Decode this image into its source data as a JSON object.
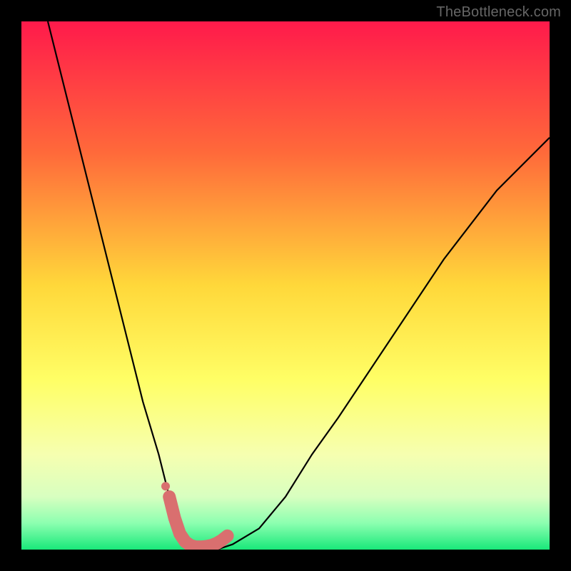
{
  "attribution": "TheBottleneck.com",
  "colors": {
    "frame": "#000000",
    "gradient_stops": [
      {
        "offset": 0,
        "color": "#ff1a4b"
      },
      {
        "offset": 0.25,
        "color": "#ff6a3a"
      },
      {
        "offset": 0.5,
        "color": "#ffd83a"
      },
      {
        "offset": 0.68,
        "color": "#ffff66"
      },
      {
        "offset": 0.82,
        "color": "#f6ffb0"
      },
      {
        "offset": 0.9,
        "color": "#d8ffc0"
      },
      {
        "offset": 0.95,
        "color": "#8cffb0"
      },
      {
        "offset": 1.0,
        "color": "#19e87a"
      }
    ],
    "curve": "#000000",
    "marker": "#d96f6f"
  },
  "chart_data": {
    "type": "line",
    "title": "",
    "xlabel": "",
    "ylabel": "",
    "xlim": [
      0,
      100
    ],
    "ylim": [
      0,
      100
    ],
    "series": [
      {
        "name": "bottleneck-curve",
        "x": [
          5,
          10,
          15,
          20,
          23,
          26,
          28,
          30,
          32,
          34,
          37,
          40,
          45,
          50,
          55,
          60,
          70,
          80,
          90,
          100
        ],
        "y": [
          100,
          80,
          60,
          40,
          28,
          18,
          10,
          4,
          1,
          0,
          0,
          1,
          4,
          10,
          18,
          25,
          40,
          55,
          68,
          78
        ]
      }
    ],
    "markers": {
      "name": "highlight-range",
      "x": [
        28,
        29,
        30,
        31,
        32,
        33,
        34,
        35,
        36,
        37,
        38,
        39
      ],
      "y": [
        10,
        6,
        3,
        1.5,
        0.8,
        0.5,
        0.5,
        0.6,
        0.8,
        1.2,
        1.8,
        2.6
      ]
    }
  }
}
